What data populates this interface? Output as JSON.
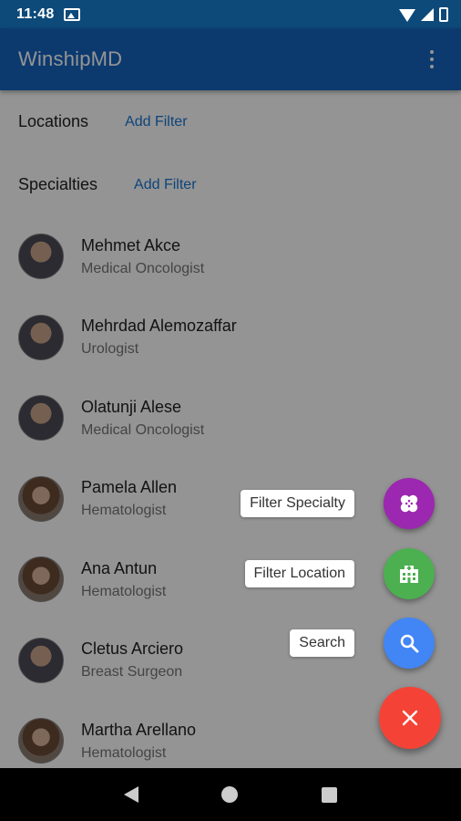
{
  "status_bar": {
    "time": "11:48",
    "battery_glyph": "▮"
  },
  "app_bar": {
    "title": "WinshipMD",
    "menu_icon": "overflow-menu-icon"
  },
  "filters": [
    {
      "label": "Locations",
      "action": "Add Filter"
    },
    {
      "label": "Specialties",
      "action": "Add Filter"
    }
  ],
  "doctors": [
    {
      "name": "Mehmet Akce",
      "specialty": "Medical Oncologist"
    },
    {
      "name": "Mehrdad Alemozaffar",
      "specialty": "Urologist"
    },
    {
      "name": "Olatunji Alese",
      "specialty": "Medical Oncologist"
    },
    {
      "name": "Pamela Allen",
      "specialty": "Hematologist"
    },
    {
      "name": "Ana Antun",
      "specialty": "Hematologist"
    },
    {
      "name": "Cletus Arciero",
      "specialty": "Breast Surgeon"
    },
    {
      "name": "Martha Arellano",
      "specialty": "Hematologist"
    }
  ],
  "fab_menu": {
    "items": [
      {
        "label": "Filter Specialty",
        "icon": "bandage-icon",
        "color": "#9c27b0"
      },
      {
        "label": "Filter Location",
        "icon": "hospital-icon",
        "color": "#4caf50"
      },
      {
        "label": "Search",
        "icon": "search-icon",
        "color": "#4285f4"
      }
    ],
    "close_icon": "close-icon",
    "close_color": "#f44336"
  },
  "colors": {
    "app_bar": "#1565c0",
    "status_bar": "#0d4a7a",
    "link": "#1976d2"
  }
}
